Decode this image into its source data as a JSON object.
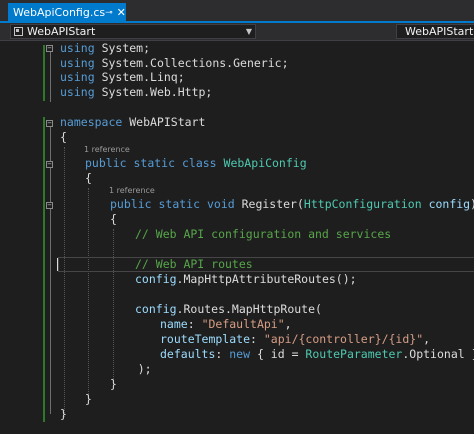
{
  "tabstrip": {
    "active_tab": {
      "label": "WebApiConfig.cs",
      "pin_glyph": "⊸",
      "close_glyph": "✕"
    }
  },
  "navbar": {
    "project_dropdown": "WebAPIStart",
    "class_dropdown": "WebAPIStart.W"
  },
  "editor": {
    "lines": [
      {
        "id": "l1",
        "tokens": [
          [
            "kw",
            "using"
          ],
          [
            "",
            "System;"
          ]
        ]
      },
      {
        "id": "l2",
        "tokens": [
          [
            "kw",
            "using"
          ],
          [
            "",
            "System.Collections.Generic;"
          ]
        ]
      },
      {
        "id": "l3",
        "tokens": [
          [
            "kw",
            "using"
          ],
          [
            "",
            "System.Linq;"
          ]
        ]
      },
      {
        "id": "l4",
        "tokens": [
          [
            "kw",
            "using"
          ],
          [
            "",
            "System.Web.Http;"
          ]
        ]
      },
      {
        "id": "l5",
        "tokens": []
      },
      {
        "id": "l6",
        "tokens": [
          [
            "kw",
            "namespace"
          ],
          [
            "",
            " WebAPIStart"
          ]
        ]
      },
      {
        "id": "l7",
        "tokens": [
          [
            "",
            "{"
          ]
        ]
      },
      {
        "id": "l8",
        "tokens": [
          [
            "kw",
            "public"
          ],
          [
            "",
            " "
          ],
          [
            "kw",
            "static"
          ],
          [
            "",
            " "
          ],
          [
            "kw",
            "class"
          ],
          [
            "",
            " "
          ],
          [
            "type",
            "WebApiConfig"
          ]
        ]
      },
      {
        "id": "l9",
        "tokens": [
          [
            "",
            "{"
          ]
        ]
      },
      {
        "id": "l10",
        "tokens": [
          [
            "kw",
            "public"
          ],
          [
            "",
            " "
          ],
          [
            "kw",
            "static"
          ],
          [
            "",
            " "
          ],
          [
            "kw",
            "void"
          ],
          [
            "",
            " Register("
          ],
          [
            "type",
            "HttpConfiguration"
          ],
          [
            "",
            " "
          ],
          [
            "param",
            "config"
          ],
          [
            "",
            ")"
          ]
        ]
      },
      {
        "id": "l11",
        "tokens": [
          [
            "",
            "{"
          ]
        ]
      },
      {
        "id": "l12",
        "tokens": [
          [
            "cmt",
            "// Web API configuration and services"
          ]
        ]
      },
      {
        "id": "l13",
        "tokens": []
      },
      {
        "id": "l14",
        "tokens": [
          [
            "cmt",
            "// Web API routes"
          ]
        ]
      },
      {
        "id": "l15",
        "tokens": [
          [
            "param",
            "config"
          ],
          [
            "",
            ".MapHttpAttributeRoutes();"
          ]
        ]
      },
      {
        "id": "l16",
        "tokens": []
      },
      {
        "id": "l17",
        "tokens": [
          [
            "param",
            "config"
          ],
          [
            "",
            ".Routes.MapHttpRoute("
          ]
        ]
      },
      {
        "id": "l18",
        "tokens": [
          [
            "param",
            "name"
          ],
          [
            "",
            ": "
          ],
          [
            "str",
            "\"DefaultApi\""
          ],
          [
            "",
            ","
          ]
        ]
      },
      {
        "id": "l19",
        "tokens": [
          [
            "param",
            "routeTemplate"
          ],
          [
            "",
            ": "
          ],
          [
            "str",
            "\"api/{controller}/{id}\""
          ],
          [
            "",
            ","
          ]
        ]
      },
      {
        "id": "l20",
        "tokens": [
          [
            "param",
            "defaults"
          ],
          [
            "",
            ": "
          ],
          [
            "kw",
            "new"
          ],
          [
            "",
            " { id = "
          ],
          [
            "type",
            "RouteParameter"
          ],
          [
            "",
            ".Optional }"
          ]
        ]
      },
      {
        "id": "l21",
        "tokens": [
          [
            "",
            "    );"
          ]
        ]
      },
      {
        "id": "l22",
        "tokens": [
          [
            "",
            "}"
          ]
        ]
      },
      {
        "id": "l23",
        "tokens": [
          [
            "",
            "}"
          ]
        ]
      },
      {
        "id": "l24",
        "tokens": [
          [
            "",
            "}"
          ]
        ]
      }
    ],
    "codelens": {
      "class_refs": "1 reference",
      "method_refs": "1 reference"
    }
  },
  "colors": {
    "keyword": "#569cd6",
    "type": "#4ec9b0",
    "string": "#d69d85",
    "comment": "#57a64a",
    "parameter": "#9cdcfe",
    "accent": "#007acc",
    "background": "#1e1e1e"
  }
}
